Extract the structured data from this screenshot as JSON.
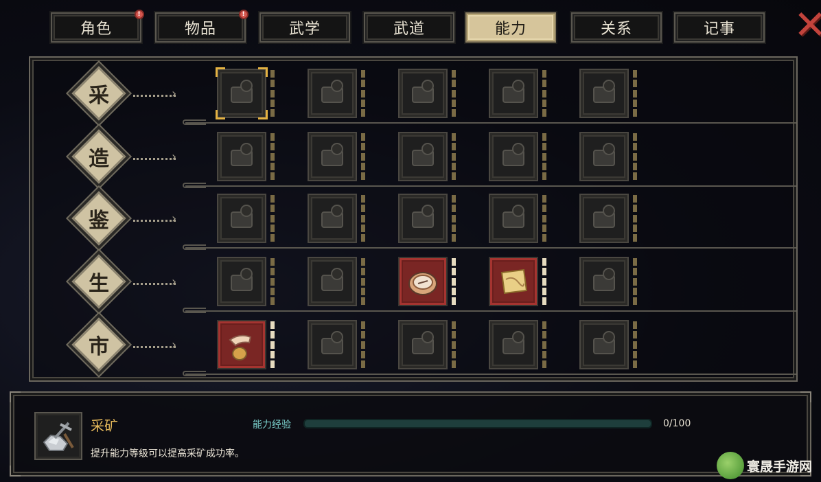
{
  "tabs": [
    {
      "label": "角色",
      "badge": "!"
    },
    {
      "label": "物品",
      "badge": "!"
    },
    {
      "label": "武学",
      "badge": ""
    },
    {
      "label": "武道",
      "badge": ""
    },
    {
      "label": "能力",
      "badge": ""
    },
    {
      "label": "关系",
      "badge": ""
    },
    {
      "label": "记事",
      "badge": ""
    }
  ],
  "active_tab": "能力",
  "close_label": "✕",
  "categories": [
    {
      "label": "采",
      "slots": [
        "pickaxe-ore-icon",
        "axe-log-icon",
        "basket-herbs-icon",
        "fishing-rod-icon",
        "spool-sewing-icon"
      ],
      "active": [
        false,
        false,
        false,
        false,
        false
      ],
      "lit": [
        false,
        false,
        false,
        false,
        false
      ]
    },
    {
      "label": "造",
      "slots": [
        "anvil-icon",
        "workbench-icon",
        "knife-craft-icon",
        "pottery-icon",
        "gem-craft-icon"
      ],
      "active": [
        false,
        false,
        false,
        false,
        false
      ],
      "lit": [
        false,
        false,
        false,
        false,
        false
      ]
    },
    {
      "label": "鉴",
      "slots": [
        "magnifier-scroll-icon",
        "magnifier-book-icon",
        "magnifier-bench-icon",
        "magnifier-bowl-icon",
        "magnifier-box-icon"
      ],
      "active": [
        false,
        false,
        false,
        false,
        false
      ],
      "lit": [
        false,
        false,
        false,
        false,
        false
      ]
    },
    {
      "label": "生",
      "slots": [
        "pot-icon",
        "abacus-icon",
        "compass-plate-icon",
        "map-icon",
        "rope-coil-icon"
      ],
      "active": [
        false,
        false,
        true,
        true,
        false
      ],
      "lit": [
        false,
        false,
        true,
        true,
        false
      ]
    },
    {
      "label": "市",
      "slots": [
        "hand-pouch-icon",
        "pointing-hand-icon",
        "mortar-icon",
        "gears-icon",
        "horn-icon"
      ],
      "active": [
        true,
        false,
        false,
        false,
        false
      ],
      "lit": [
        true,
        false,
        false,
        false,
        false
      ]
    }
  ],
  "selected": {
    "row": 0,
    "col": 0
  },
  "info": {
    "icon": "pickaxe-ore-icon",
    "title": "采矿",
    "description": "提升能力等级可以提高采矿成功率。",
    "exp_label": "能力经验",
    "exp_value": "0/100",
    "exp_progress": 0
  },
  "watermark": {
    "text": "寰晟手游网"
  },
  "colors": {
    "accent_gold": "#e4b242",
    "tab_active": "#d6c59b",
    "slot_active": "#7a2624",
    "exp_bar": "#6fc7c0",
    "badge": "#d4574f"
  }
}
